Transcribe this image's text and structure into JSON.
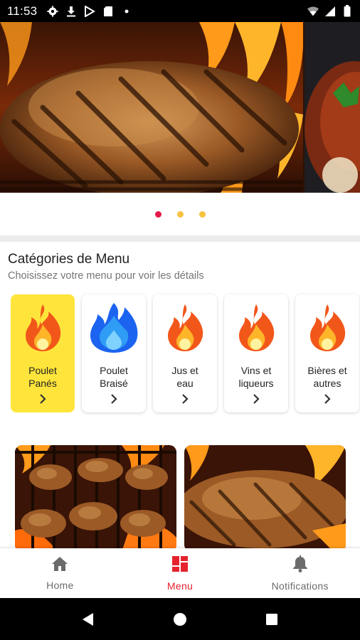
{
  "status_bar": {
    "time": "11:53",
    "left_icons": [
      "settings-icon",
      "download-icon",
      "play-store-icon",
      "sd-card-icon",
      "dot-icon"
    ],
    "right_icons": [
      "wifi-icon",
      "signal-icon",
      "battery-icon"
    ]
  },
  "carousel": {
    "slides": [
      "grilled-chicken-on-fire",
      "braised-chicken-plate"
    ],
    "active_index": 0,
    "dot_colors": {
      "active": "#e5194a",
      "inactive": "#f5c242"
    }
  },
  "categories_section": {
    "title": "Catégories de Menu",
    "subtitle": "Choisissez votre menu pour voir les détails",
    "items": [
      {
        "line1": "Poulet",
        "line2": "Panés",
        "icon": "fire-orange-icon",
        "active": true
      },
      {
        "line1": "Poulet",
        "line2": "Braisé",
        "icon": "fire-blue-icon",
        "active": false
      },
      {
        "line1": "Jus et",
        "line2": "eau",
        "icon": "fire-orange-icon",
        "active": false
      },
      {
        "line1": "Vins et",
        "line2": "liqueurs",
        "icon": "fire-orange-icon",
        "active": false
      },
      {
        "line1": "Bières et",
        "line2": "autres",
        "icon": "fire-orange-icon",
        "active": false
      }
    ]
  },
  "tiles": [
    "grilled-drumsticks-image",
    "grilled-chicken-image"
  ],
  "bottom_nav": {
    "items": [
      {
        "label": "Home",
        "icon": "home-icon",
        "active": false
      },
      {
        "label": "Menu",
        "icon": "menu-grid-icon",
        "active": true
      },
      {
        "label": "Notifications",
        "icon": "bell-icon",
        "active": false
      }
    ]
  },
  "colors": {
    "accent": "#e5222d",
    "active_card": "#ffe53b",
    "divider": "#ececec"
  }
}
